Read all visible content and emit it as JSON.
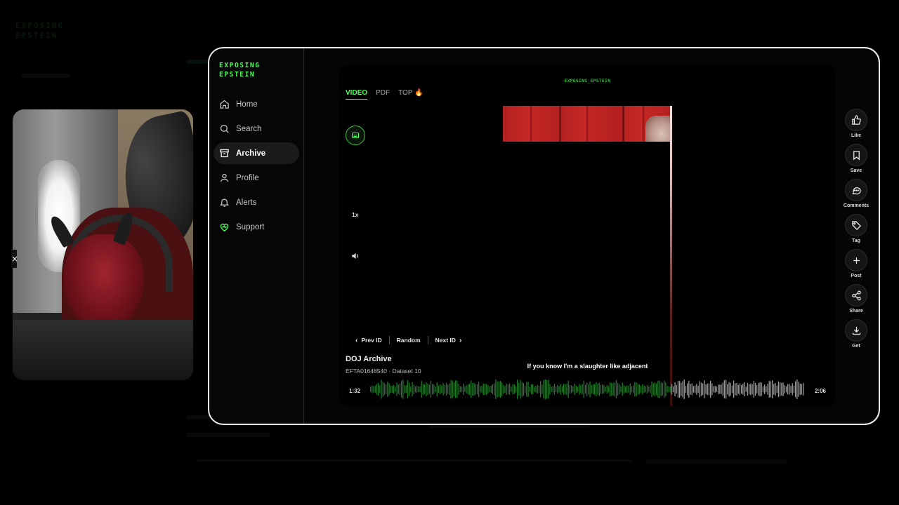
{
  "app": {
    "logo": [
      "EXPOSING",
      "EPSTEIN"
    ],
    "accent": "#4cff5a"
  },
  "sidebar": {
    "items": [
      {
        "label": "Home",
        "icon": "home-icon",
        "active": false
      },
      {
        "label": "Search",
        "icon": "search-icon",
        "active": false
      },
      {
        "label": "Archive",
        "icon": "archive-icon",
        "active": true
      },
      {
        "label": "Profile",
        "icon": "person-icon",
        "active": false
      },
      {
        "label": "Alerts",
        "icon": "bell-icon",
        "active": false
      },
      {
        "label": "Support",
        "icon": "heart-icon",
        "active": false
      }
    ]
  },
  "player": {
    "brand": "EXPOSING_EPSTEIN",
    "tabs": [
      {
        "label": "VIDEO",
        "active": true
      },
      {
        "label": "PDF",
        "active": false
      },
      {
        "label": "TOP 🔥",
        "active": false
      }
    ],
    "speed": "1x",
    "nav": {
      "prev": "Prev ID",
      "random": "Random",
      "next": "Next ID"
    },
    "doc_title": "DOJ Archive",
    "doc_sub": "EFTA01648540 · Dataset 10",
    "subtitle": "If you know I'm a slaughter like adjacent",
    "time_current": "1:32",
    "time_total": "2:06",
    "progress": 0.69
  },
  "actions": [
    {
      "label": "Like",
      "icon": "thumbs-up-icon"
    },
    {
      "label": "Save",
      "icon": "bookmark-icon"
    },
    {
      "label": "Comments",
      "icon": "comment-icon"
    },
    {
      "label": "Tag",
      "icon": "tag-icon"
    },
    {
      "label": "Post",
      "icon": "plus-icon"
    },
    {
      "label": "Share",
      "icon": "share-icon"
    },
    {
      "label": "Get",
      "icon": "download-icon"
    }
  ]
}
